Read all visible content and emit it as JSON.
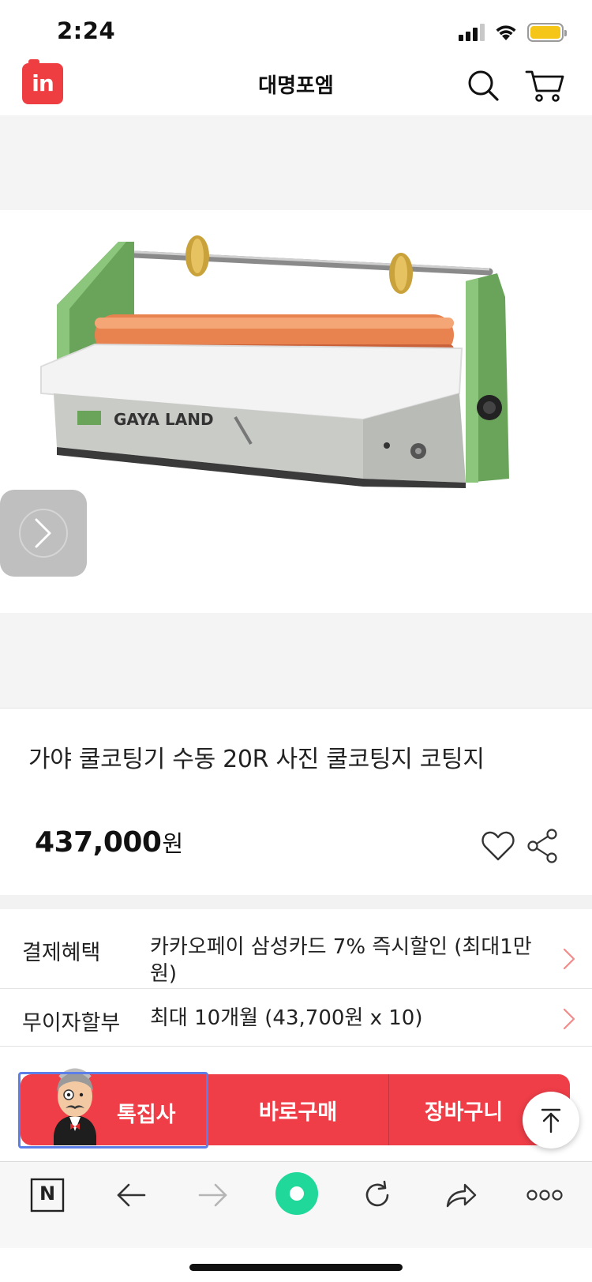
{
  "status_bar": {
    "time": "2:24",
    "battery_color": "#f5c518"
  },
  "header": {
    "logo_text": "in",
    "store_name": "대명포엠",
    "icons": [
      "search-icon",
      "cart-icon"
    ],
    "brand_color": "#ef3e42"
  },
  "gallery": {
    "next_icon": "chevron-right-icon",
    "product_image_alt": "laminator-machine"
  },
  "product": {
    "title": "가야 쿨코팅기 수동 20R 사진 쿨코팅지 코팅지",
    "price": "437,000",
    "price_unit": "원",
    "wish_icon": "heart-icon",
    "share_icon": "share-icon"
  },
  "benefits": [
    {
      "label": "결제혜택",
      "value": "카카오페이 삼성카드 7% 즉시할인 (최대1만원)"
    },
    {
      "label": "무이자할부",
      "value": "최대 10개월 (43,700원 x 10)"
    }
  ],
  "cta": {
    "special_label": "톡집사",
    "buy_label": "바로구매",
    "cart_label": "장바구니",
    "color": "#ef3e48"
  },
  "toolbar": {
    "icons": [
      "naver-n-icon",
      "back-arrow-icon",
      "forward-arrow-icon",
      "green-dot-icon",
      "refresh-icon",
      "share-forward-icon",
      "more-icon"
    ],
    "naver_label": "N",
    "accent_color": "#20d89a"
  }
}
